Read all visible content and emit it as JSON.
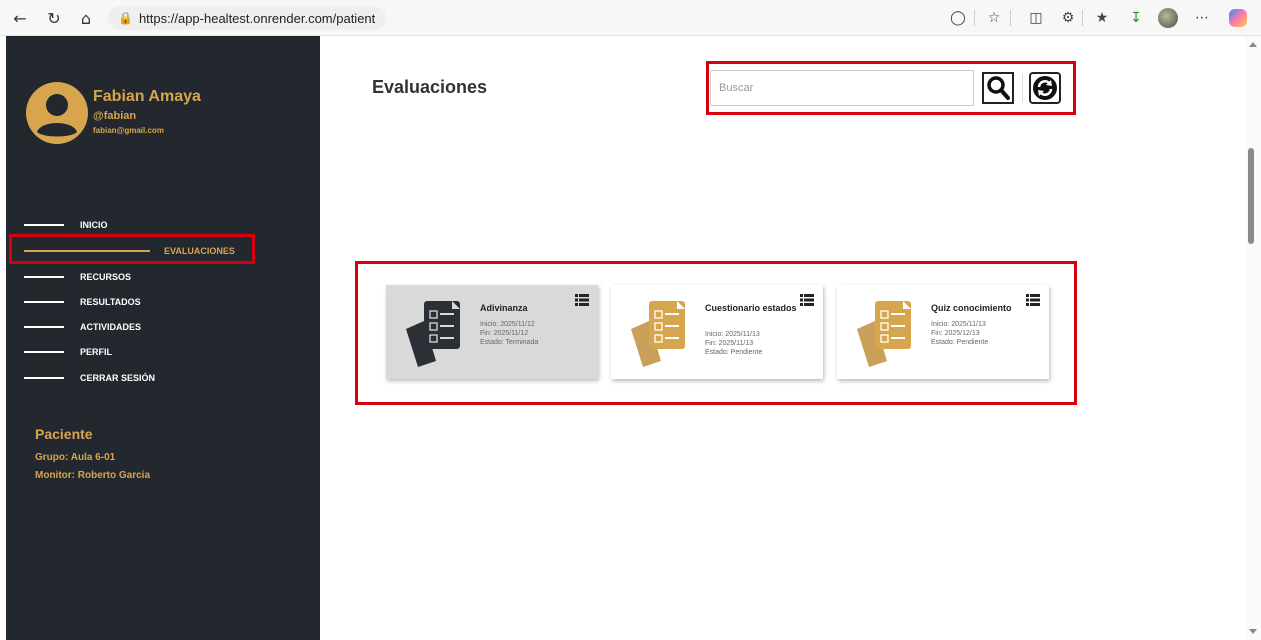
{
  "browser": {
    "url": "https://app-healtest.onrender.com/patient",
    "icons": [
      "back-arrow-icon",
      "reload-icon",
      "home-icon",
      "lock-icon",
      "reading-view-icon",
      "favorite-star-icon",
      "split-screen-icon",
      "extensions-icon",
      "favorites-icon",
      "downloads-icon",
      "profile-avatar-icon",
      "more-icon",
      "copilot-icon"
    ]
  },
  "user": {
    "name": "Fabian Amaya",
    "handle": "@fabian",
    "email": "fabian@gmail.com"
  },
  "sidebar": {
    "items": [
      {
        "label": "INICIO",
        "active": false
      },
      {
        "label": "EVALUACIONES",
        "active": true
      },
      {
        "label": "RECURSOS",
        "active": false
      },
      {
        "label": "RESULTADOS",
        "active": false
      },
      {
        "label": "ACTIVIDADES",
        "active": false
      },
      {
        "label": "PERFIL",
        "active": false
      },
      {
        "label": "CERRAR SESIÓN",
        "active": false
      }
    ],
    "role": "Paciente",
    "group": "Grupo: Aula 6-01",
    "monitor": "Monitor: Roberto Garcia"
  },
  "main": {
    "title": "Evaluaciones",
    "search": {
      "placeholder": "Buscar",
      "value": ""
    }
  },
  "cards": [
    {
      "title": "Adivinanza",
      "start": "Inicio: 2025/11/12",
      "end": "Fin: 2025/11/12",
      "status": "Estado: Terminada"
    },
    {
      "title": "Cuestionario estados",
      "start": "Inicio: 2025/11/13",
      "end": "Fin: 2025/11/13",
      "status": "Estado: Pendiente"
    },
    {
      "title": "Quiz conocimiento",
      "start": "Inicio: 2025/11/13",
      "end": "Fin: 2025/12/13",
      "status": "Estado: Pendiente"
    }
  ],
  "colors": {
    "sidebar_bg": "#23272e",
    "accent_gold": "#d6a54e",
    "completed_icon": "#2b2f36",
    "completed_card_bg": "#d9d9d9",
    "highlight_red": "#d6000f"
  }
}
